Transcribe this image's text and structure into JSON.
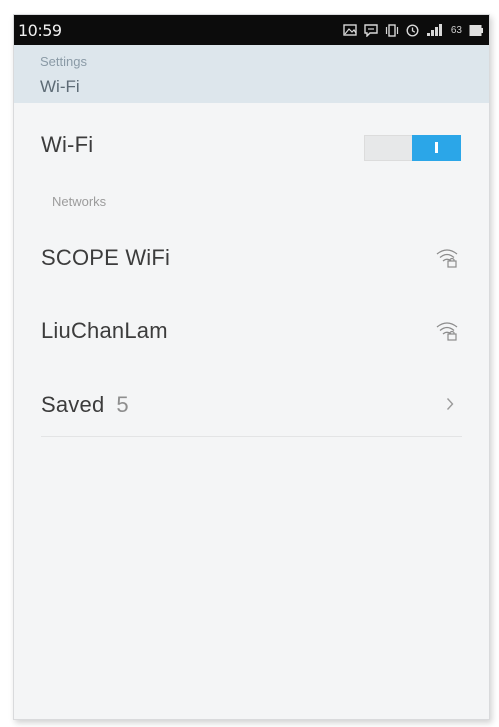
{
  "status_bar": {
    "time": "10:59",
    "battery_level": "63"
  },
  "header": {
    "breadcrumb": "Settings",
    "title": "Wi-Fi"
  },
  "wifi_toggle": {
    "label": "Wi-Fi",
    "state": "on",
    "accent_color": "#2ba6e8"
  },
  "networks": {
    "section_title": "Networks",
    "items": [
      {
        "ssid": "SCOPE WiFi",
        "icon": "wifi-lock-icon"
      },
      {
        "ssid": "LiuChanLam",
        "icon": "wifi-lock-icon"
      }
    ]
  },
  "saved": {
    "label": "Saved",
    "count": "5",
    "icon": "chevron-right-icon"
  }
}
